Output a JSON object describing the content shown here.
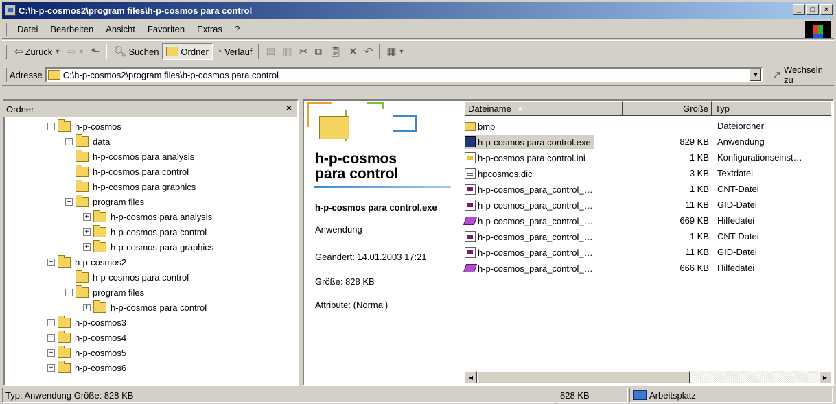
{
  "window": {
    "title": "C:\\h-p-cosmos2\\program files\\h-p-cosmos para control",
    "controls": {
      "minimize": "_",
      "maximize": "□",
      "close": "×"
    }
  },
  "menubar": {
    "items": [
      "Datei",
      "Bearbeiten",
      "Ansicht",
      "Favoriten",
      "Extras",
      "?"
    ]
  },
  "toolbar": {
    "back": "Zurück",
    "search": "Suchen",
    "folders": "Ordner",
    "history": "Verlauf"
  },
  "address": {
    "label": "Adresse",
    "value": "C:\\h-p-cosmos2\\program files\\h-p-cosmos para control",
    "go": "Wechseln zu"
  },
  "folderpane": {
    "title": "Ordner",
    "close": "×",
    "tree": [
      {
        "label": "h-p-cosmos",
        "level": 0,
        "exp": "−"
      },
      {
        "label": "data",
        "level": 1,
        "exp": "+"
      },
      {
        "label": "h-p-cosmos para analysis",
        "level": 1,
        "exp": ""
      },
      {
        "label": "h-p-cosmos para control",
        "level": 1,
        "exp": ""
      },
      {
        "label": "h-p-cosmos para graphics",
        "level": 1,
        "exp": ""
      },
      {
        "label": "program files",
        "level": 1,
        "exp": "−"
      },
      {
        "label": "h-p-cosmos para analysis",
        "level": 2,
        "exp": "+"
      },
      {
        "label": "h-p-cosmos para control",
        "level": 2,
        "exp": "+"
      },
      {
        "label": "h-p-cosmos para graphics",
        "level": 2,
        "exp": "+"
      },
      {
        "label": "h-p-cosmos2",
        "level": 0,
        "exp": "−"
      },
      {
        "label": "h-p-cosmos para control",
        "level": 1,
        "exp": ""
      },
      {
        "label": "program files",
        "level": 1,
        "exp": "−"
      },
      {
        "label": "h-p-cosmos para control",
        "level": 2,
        "exp": "+"
      },
      {
        "label": "h-p-cosmos3",
        "level": 0,
        "exp": "+"
      },
      {
        "label": "h-p-cosmos4",
        "level": 0,
        "exp": "+"
      },
      {
        "label": "h-p-cosmos5",
        "level": 0,
        "exp": "+"
      },
      {
        "label": "h-p-cosmos6",
        "level": 0,
        "exp": "+"
      }
    ]
  },
  "preview": {
    "title_line1": "h-p-cosmos",
    "title_line2": "para control",
    "filename": "h-p-cosmos para control.exe",
    "type": "Anwendung",
    "changed": "Geändert: 14.01.2003 17:21",
    "size": "Größe: 828 KB",
    "attributes": "Attribute: (Normal)"
  },
  "filelist": {
    "columns": {
      "name": "Dateiname",
      "size": "Größe",
      "type": "Typ"
    },
    "rows": [
      {
        "name": "bmp",
        "size": "",
        "type": "Dateiordner",
        "icon": "folder"
      },
      {
        "name": "h-p-cosmos para control.exe",
        "size": "829 KB",
        "type": "Anwendung",
        "icon": "exe"
      },
      {
        "name": "h-p-cosmos para control.ini",
        "size": "1 KB",
        "type": "Konfigurationseinst…",
        "icon": "ini"
      },
      {
        "name": "hpcosmos.dic",
        "size": "3 KB",
        "type": "Textdatei",
        "icon": "txt"
      },
      {
        "name": "h-p-cosmos_para_control_…",
        "size": "1 KB",
        "type": "CNT-Datei",
        "icon": "cnt"
      },
      {
        "name": "h-p-cosmos_para_control_…",
        "size": "11 KB",
        "type": "GID-Datei",
        "icon": "cnt"
      },
      {
        "name": "h-p-cosmos_para_control_…",
        "size": "669 KB",
        "type": "Hilfedatei",
        "icon": "hlp"
      },
      {
        "name": "h-p-cosmos_para_control_…",
        "size": "1 KB",
        "type": "CNT-Datei",
        "icon": "cnt"
      },
      {
        "name": "h-p-cosmos_para_control_…",
        "size": "11 KB",
        "type": "GID-Datei",
        "icon": "cnt"
      },
      {
        "name": "h-p-cosmos_para_control_…",
        "size": "666 KB",
        "type": "Hilfedatei",
        "icon": "hlp"
      }
    ]
  },
  "statusbar": {
    "info": "Typ: Anwendung Größe: 828 KB",
    "size": "828 KB",
    "zone": "Arbeitsplatz"
  }
}
